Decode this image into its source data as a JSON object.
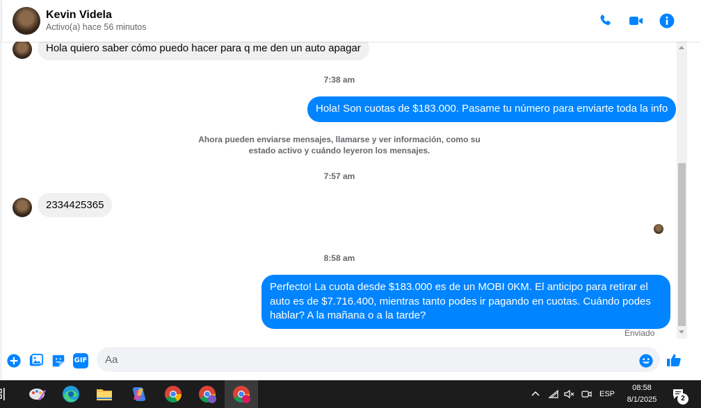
{
  "header": {
    "contact_name": "Kevin Videla",
    "status": "Activo(a) hace 56 minutos",
    "icons": [
      "phone-icon",
      "video-call-icon",
      "info-icon"
    ],
    "accent_color": "#0084ff"
  },
  "messages": {
    "in_1": "Hola quiero saber cómo puedo hacer para q me den un auto apagar",
    "time_1": "7:38 am",
    "out_1": "Hola! Son cuotas de $183.000. Pasame tu número para enviarte toda la info",
    "notice": "Ahora pueden enviarse mensajes, llamarse y ver información, como su estado activo y cuándo leyeron los mensajes.",
    "time_2": "7:57 am",
    "in_2": "2334425365",
    "time_3": "8:58 am",
    "out_2": "Perfecto! La cuota desde $183.000 es de un MOBI 0KM. El anticipo para retirar el auto es de $7.716.400, mientras tanto podes ir pagando en cuotas. Cuándo podes hablar? A la mañana o a la tarde?",
    "delivery_status": "Enviado"
  },
  "composer": {
    "placeholder": "Aa",
    "icons": [
      "add-icon",
      "image-icon",
      "sticker-icon",
      "gif-icon",
      "emoji-icon",
      "like-icon"
    ],
    "gif_label": "GIF"
  },
  "taskbar": {
    "language": "ESP",
    "clock_time": "08:58",
    "clock_date": "8/1/2025",
    "notification_count": "2",
    "apps": [
      "paint-icon",
      "edge-icon",
      "file-explorer-icon",
      "copilot-icon",
      "chrome-icon",
      "chrome-profile-icon",
      "chrome-active-icon"
    ]
  }
}
